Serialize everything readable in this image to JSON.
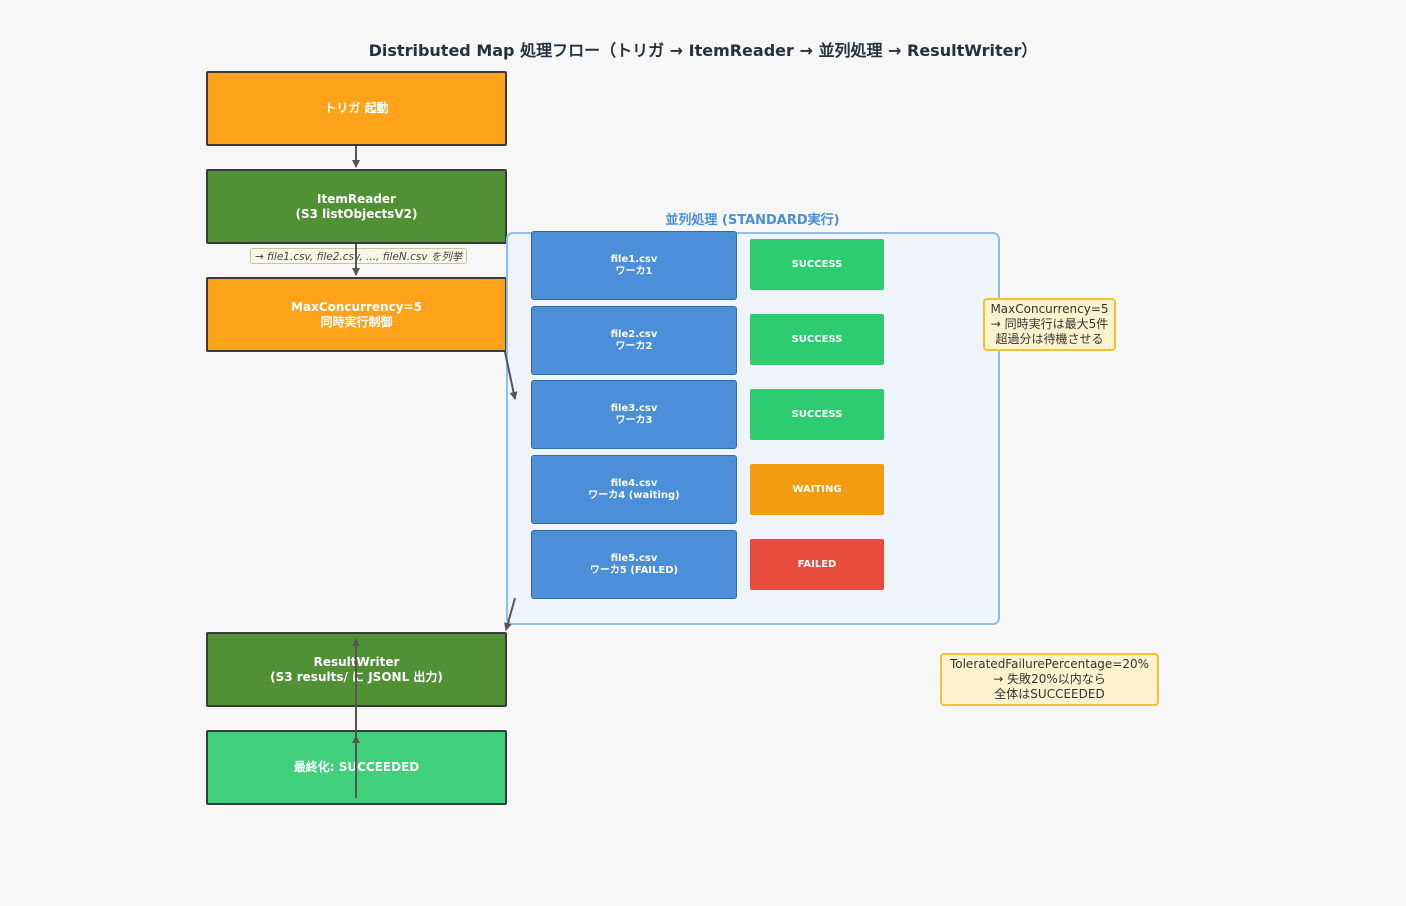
{
  "title": "Distributed Map 処理フロー（トリガ → ItemReader → 並列処理 → ResultWriter）",
  "flow": {
    "trigger": "トリガ 起動",
    "item_reader": "ItemReader\n(S3 listObjectsV2)",
    "item_list_note": "→ file1.csv, file2.csv, ..., fileN.csv を列挙",
    "concurrency": "MaxConcurrency=5\n同時実行制御",
    "result_writer": "ResultWriter\n(S3 results/ に JSONL 出力)",
    "final": "最終化: SUCCEEDED"
  },
  "panel": {
    "title": "並列処理 (STANDARD実行)",
    "workers": [
      {
        "label": "file1.csv\nワーカ1",
        "status": "SUCCESS"
      },
      {
        "label": "file2.csv\nワーカ2",
        "status": "SUCCESS"
      },
      {
        "label": "file3.csv\nワーカ3",
        "status": "SUCCESS"
      },
      {
        "label": "file4.csv\nワーカ4 (waiting)",
        "status": "WAITING"
      },
      {
        "label": "file5.csv\nワーカ5 (FAILED)",
        "status": "FAILED"
      }
    ]
  },
  "notes": {
    "concurrency_note": "MaxConcurrency=5\n→ 同時実行は最大5件\n超過分は待機させる",
    "tolerance_note": "ToleratedFailurePercentage=20%\n→ 失敗20%以内なら\n全体はSUCCEEDED"
  },
  "colors": {
    "orange": "#ffa31a",
    "green": "#519136",
    "light_green": "#40d07c",
    "worker_blue": "#4a8fd8",
    "success": "#2ecc71",
    "waiting": "#f39c12",
    "failed": "#e74c3c"
  }
}
